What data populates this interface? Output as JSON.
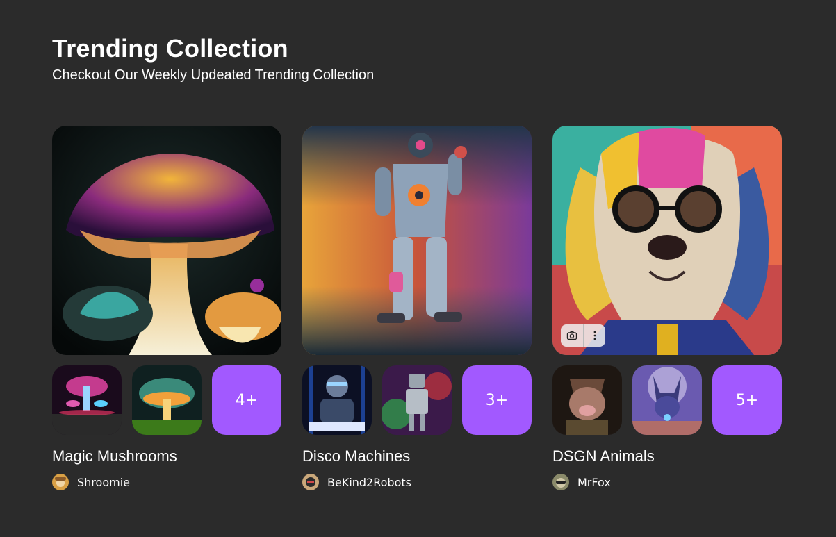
{
  "header": {
    "title": "Trending Collection",
    "subtitle": "Checkout Our Weekly Updeated Trending Collection"
  },
  "collections": [
    {
      "name": "Magic Mushrooms",
      "artist": "Shroomie",
      "more_label": "4+",
      "hero_image": "glowing-mushroom-art",
      "thumbnails": [
        "neon-mushroom-art",
        "glowing-mushroom-grass-art"
      ]
    },
    {
      "name": "Disco Machines",
      "artist": "BeKind2Robots",
      "more_label": "3+",
      "hero_image": "neon-robot-astronaut-art",
      "thumbnails": [
        "robot-dj-art",
        "colorful-robot-art"
      ]
    },
    {
      "name": "DSGN Animals",
      "artist": "MrFox",
      "more_label": "5+",
      "hero_image": "colorful-dog-with-glasses-art",
      "thumbnails": [
        "boar-warrior-art",
        "cosmic-fox-art"
      ]
    }
  ],
  "image_tools": [
    "camera-icon",
    "more-vertical-icon"
  ],
  "colors": {
    "background": "#2b2b2b",
    "accent": "#a259ff",
    "text": "#ffffff"
  }
}
